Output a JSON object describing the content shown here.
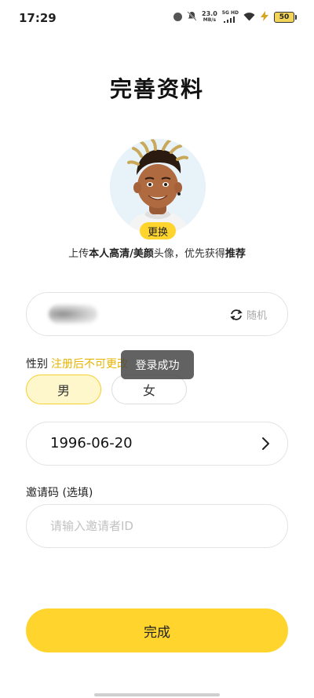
{
  "status_bar": {
    "time": "17:29",
    "net_speed_value": "23.0",
    "net_speed_unit": "MB/s",
    "network": "5G HD",
    "battery": "50"
  },
  "page": {
    "title": "完善资料"
  },
  "avatar": {
    "change_label": "更换",
    "hint_prefix": "上传",
    "hint_bold1": "本人高清/美颜",
    "hint_mid": "头像，优先获得",
    "hint_bold2": "推荐"
  },
  "nickname": {
    "random_label": "随机"
  },
  "gender": {
    "label": "性别",
    "warning": "注册后不可更改",
    "options": [
      "男",
      "女"
    ],
    "selected": "男"
  },
  "toast": {
    "message": "登录成功"
  },
  "birthday": {
    "value": "1996-06-20"
  },
  "invite": {
    "label": "邀请码 (选填)",
    "placeholder": "请输入邀请者ID",
    "value": ""
  },
  "submit": {
    "label": "完成"
  },
  "colors": {
    "accent": "#ffd52d",
    "warning_text": "#e8b400"
  }
}
